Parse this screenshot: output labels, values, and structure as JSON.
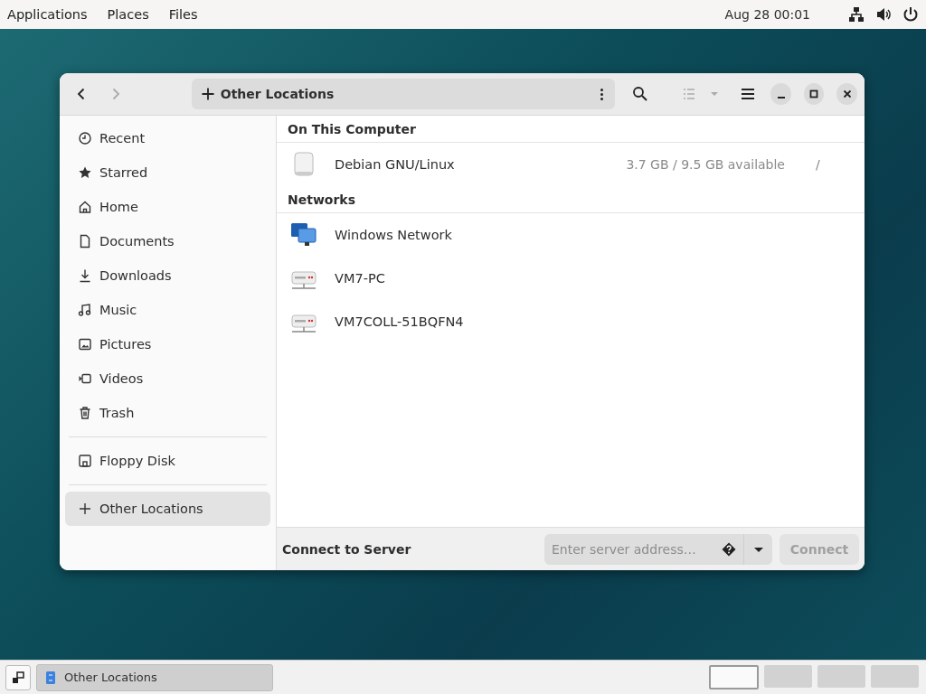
{
  "top_bar": {
    "menus": [
      "Applications",
      "Places",
      "Files"
    ],
    "clock": "Aug 28  00:01"
  },
  "window": {
    "path": "Other Locations",
    "sidebar": {
      "groups": [
        [
          {
            "label": "Recent",
            "selected": false
          },
          {
            "label": "Starred",
            "selected": false
          },
          {
            "label": "Home",
            "selected": false
          },
          {
            "label": "Documents",
            "selected": false
          },
          {
            "label": "Downloads",
            "selected": false
          },
          {
            "label": "Music",
            "selected": false
          },
          {
            "label": "Pictures",
            "selected": false
          },
          {
            "label": "Videos",
            "selected": false
          },
          {
            "label": "Trash",
            "selected": false
          }
        ],
        [
          {
            "label": "Floppy Disk",
            "selected": false
          }
        ],
        [
          {
            "label": "Other Locations",
            "selected": true
          }
        ]
      ]
    },
    "sections": [
      {
        "title": "On This Computer",
        "rows": [
          {
            "name": "Debian GNU/Linux",
            "info": "3.7 GB / 9.5 GB available",
            "path": "/"
          }
        ]
      },
      {
        "title": "Networks",
        "rows": [
          {
            "name": "Windows Network"
          },
          {
            "name": "VM7-PC"
          },
          {
            "name": "VM7COLL-51BQFN4"
          }
        ]
      }
    ],
    "connect": {
      "label": "Connect to Server",
      "placeholder": "Enter server address…",
      "button": "Connect",
      "disabled": true
    }
  },
  "taskbar": {
    "task": "Other Locations",
    "workspaces": [
      {
        "selected": true
      },
      {
        "selected": false
      },
      {
        "selected": false
      },
      {
        "selected": false
      }
    ]
  }
}
